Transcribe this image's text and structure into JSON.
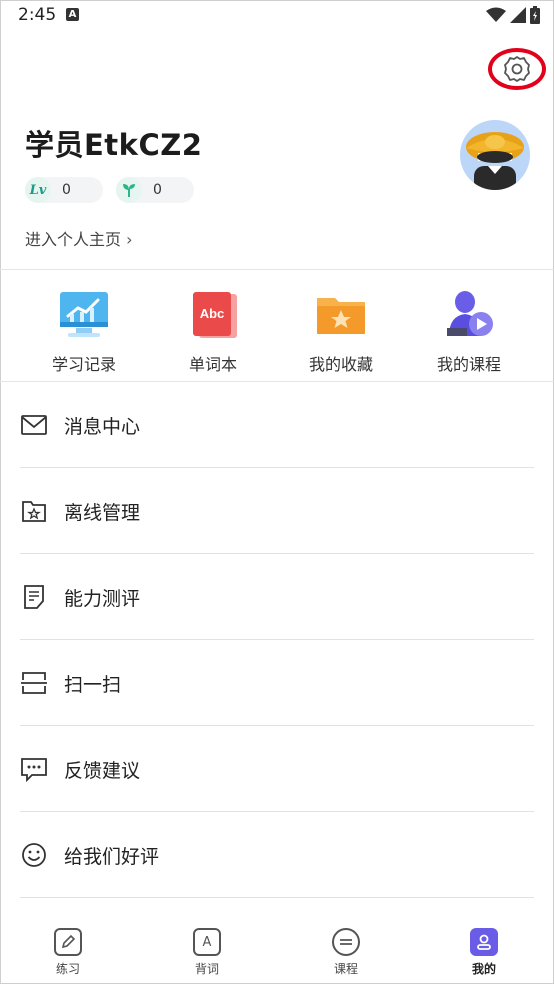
{
  "status_bar": {
    "time": "2:45",
    "notification_icon": "A"
  },
  "profile": {
    "username": "学员EtkCZ2",
    "level_badge_text": "Lv",
    "level_value": "0",
    "growth_value": "0",
    "home_link": "进入个人主页"
  },
  "quick_actions": [
    {
      "label": "学习记录",
      "icon": "monitor-chart-icon"
    },
    {
      "label": "单词本",
      "icon": "word-book-icon",
      "icon_text": "Abc"
    },
    {
      "label": "我的收藏",
      "icon": "star-folder-icon"
    },
    {
      "label": "我的课程",
      "icon": "course-play-icon"
    }
  ],
  "menu": [
    {
      "label": "消息中心",
      "icon": "envelope-icon"
    },
    {
      "label": "离线管理",
      "icon": "folder-star-icon"
    },
    {
      "label": "能力测评",
      "icon": "document-icon"
    },
    {
      "label": "扫一扫",
      "icon": "scan-icon"
    },
    {
      "label": "反馈建议",
      "icon": "chat-bubble-icon"
    },
    {
      "label": "给我们好评",
      "icon": "smile-icon"
    }
  ],
  "tabbar": {
    "tabs": [
      {
        "label": "练习",
        "icon": "pencil-icon"
      },
      {
        "label": "背词",
        "icon": "letter-a-icon",
        "icon_text": "A"
      },
      {
        "label": "课程",
        "icon": "list-icon"
      },
      {
        "label": "我的",
        "icon": "person-icon",
        "active": true
      }
    ]
  },
  "colors": {
    "accent": "#6b5ce7",
    "settings_highlight": "#e2001a",
    "level_green": "#1a9c86"
  }
}
